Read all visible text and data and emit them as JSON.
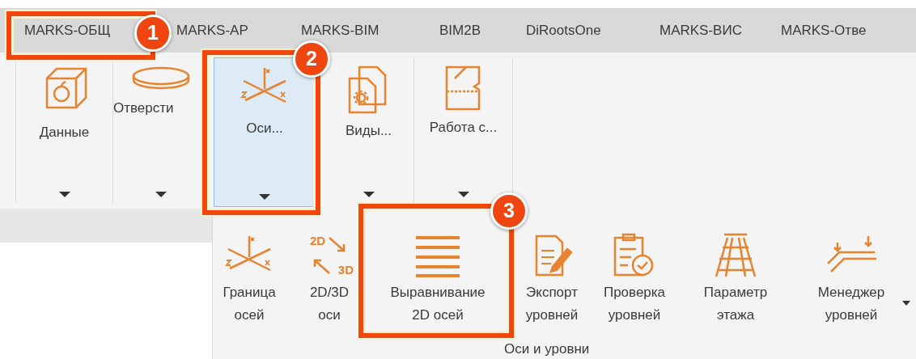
{
  "ribbon": {
    "tabs": [
      {
        "label": "MARKS-ОБЩ"
      },
      {
        "label": "MARKS-AP"
      },
      {
        "label": "MARKS-BIM"
      },
      {
        "label": "BIM2B"
      },
      {
        "label": "DiRootsOne"
      },
      {
        "label": "MARKS-ВИС"
      },
      {
        "label": "MARKS-Отве"
      }
    ],
    "buttons": [
      {
        "label": "Данные",
        "selected": false
      },
      {
        "label": "Отверсти",
        "selected": false
      },
      {
        "label": "Оси...",
        "selected": true
      },
      {
        "label": "Виды...",
        "selected": false
      },
      {
        "label": "Работа с...",
        "selected": false
      }
    ]
  },
  "dropdown_panel": {
    "items": [
      {
        "label": "Граница\nосей"
      },
      {
        "label": "2D/3D\nоси",
        "icon_labels": [
          "2D",
          "3D"
        ]
      },
      {
        "label": "Выравнивание\n2D осей"
      },
      {
        "label": "Экспорт\nуровней"
      },
      {
        "label": "Проверка\nуровней"
      },
      {
        "label": "Параметр\nэтажа"
      },
      {
        "label": "Менеджер\nуровней"
      }
    ],
    "group_label": "Оси и уровни"
  },
  "callouts": [
    {
      "number": "1"
    },
    {
      "number": "2"
    },
    {
      "number": "3"
    }
  ]
}
